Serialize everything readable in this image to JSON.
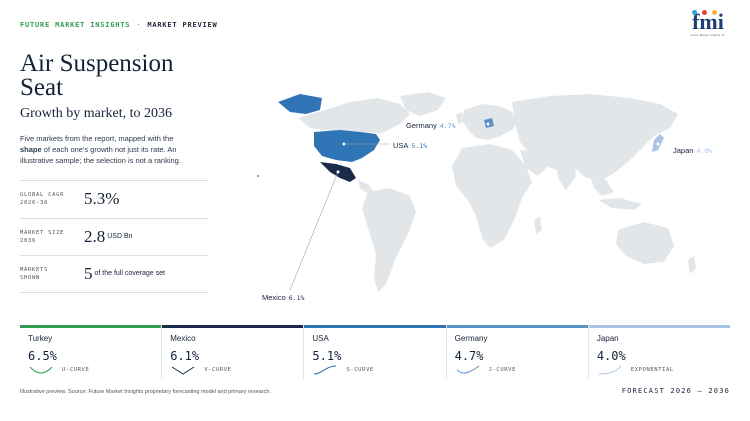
{
  "header": {
    "brand": "FUTURE MARKET INSIGHTS",
    "separator": "·",
    "section": "MARKET PREVIEW"
  },
  "logo": {
    "text": "fmi",
    "sub": "Future Market Insights Inc.",
    "dot_colors": [
      "#2aa3d6",
      "#e8414a",
      "#f2b233",
      "#46b36b"
    ]
  },
  "title": "Air Suspension Seat",
  "subtitle": "Growth by market, to 2036",
  "description": {
    "part1": "Five markets from the report, mapped with the ",
    "bold": "shape",
    "part2": " of each one's growth not just its rate. An illustrative sample; the selection is not a ranking."
  },
  "stats": [
    {
      "label": "GLOBAL CAGR\n2026-36",
      "value": "5.3%",
      "unit": ""
    },
    {
      "label": "MARKET SIZE\n2036",
      "value": "2.8",
      "unit": "USD Bn"
    },
    {
      "label": "MARKETS\nSHOWN",
      "value": "5",
      "unit": "of the full coverage set"
    }
  ],
  "map_callouts": [
    {
      "country": "Germany",
      "pct": "4.7%"
    },
    {
      "country": "USA",
      "pct": "5.1%"
    },
    {
      "country": "Japan",
      "pct": "4.0%"
    },
    {
      "country": "Mexico",
      "pct": "6.1%"
    }
  ],
  "markets": [
    {
      "name": "Turkey",
      "pct": "6.5%",
      "shape": "U-CURVE",
      "color": "#2e9e53"
    },
    {
      "name": "Mexico",
      "pct": "6.1%",
      "shape": "V-CURVE",
      "color": "#1b2a4a"
    },
    {
      "name": "USA",
      "pct": "5.1%",
      "shape": "S-CURVE",
      "color": "#2f74b5"
    },
    {
      "name": "Germany",
      "pct": "4.7%",
      "shape": "J-CURVE",
      "color": "#5b93c9"
    },
    {
      "name": "Japan",
      "pct": "4.0%",
      "shape": "EXPONENTIAL",
      "color": "#a8c6e4"
    }
  ],
  "colors": {
    "land": "#e3e6e9",
    "usa": "#2f74b5",
    "mexico": "#1b2a4a",
    "germany": "#5b93c9",
    "japan": "#a8c6e4"
  },
  "footer": {
    "note": "Illustrative preview. Source: Future Market Insights proprietary forecasting model and primary research.",
    "right": "FORECAST 2026 – 2036"
  }
}
